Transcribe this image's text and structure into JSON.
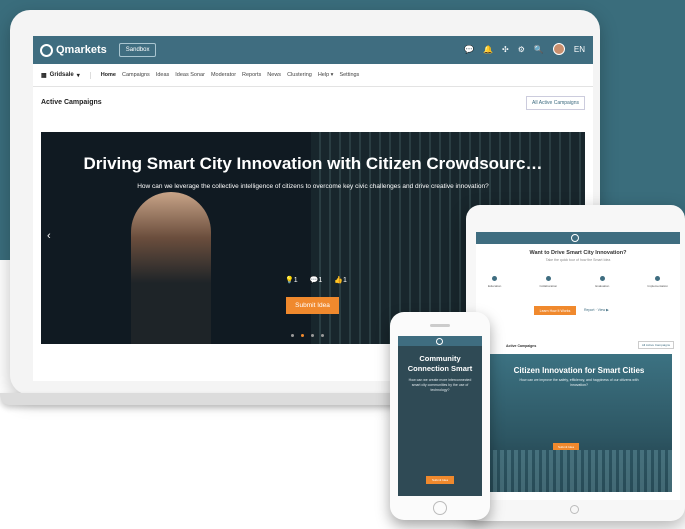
{
  "laptop": {
    "app": {
      "logo_text": "Qmarkets",
      "env_badge": "Sandbox",
      "lang": "EN"
    },
    "nav": {
      "view_selector": "Gridsale",
      "items": [
        "Home",
        "Campaigns",
        "Ideas",
        "Ideas Sonar",
        "Moderator",
        "Reports",
        "News",
        "Clustering",
        "Help ▾",
        "Settings"
      ]
    },
    "section": {
      "title": "Active Campaigns",
      "all_button": "All Active Campaigns"
    },
    "hero": {
      "title": "Driving Smart City Innovation with Citizen Crowdsourc…",
      "subtitle": "How can we leverage the collective intelligence of citizens to overcome key civic challenges and drive creative innovation?",
      "stats": {
        "ideas": "1",
        "comments": "1",
        "likes": "1"
      },
      "submit_label": "Submit Idea"
    }
  },
  "tablet": {
    "title": "Want to Drive Smart City Innovation?",
    "subtitle": "Take the quick tour of how the Smart Idea",
    "steps": [
      "Education",
      "Collaboration",
      "Evaluation",
      "Implementation"
    ],
    "start_button": "Learn How It Works",
    "link": "Report · View ▶",
    "section_title": "Active Campaigns",
    "all_button": "All Active Campaigns",
    "hero_title": "Citizen Innovation for Smart Cities",
    "hero_subtitle": "How can we improve the safety, efficiency, and happiness of our citizens with innovation?",
    "hero_button": "Submit Idea"
  },
  "phone": {
    "title": "Community Connection Smart",
    "subtitle": "How can we create more interconnected smart city communities by the use of technology?",
    "button": "Submit Idea"
  },
  "colors": {
    "brand": "#3f6d80",
    "accent": "#f0892d",
    "background": "#3a6d7c"
  }
}
